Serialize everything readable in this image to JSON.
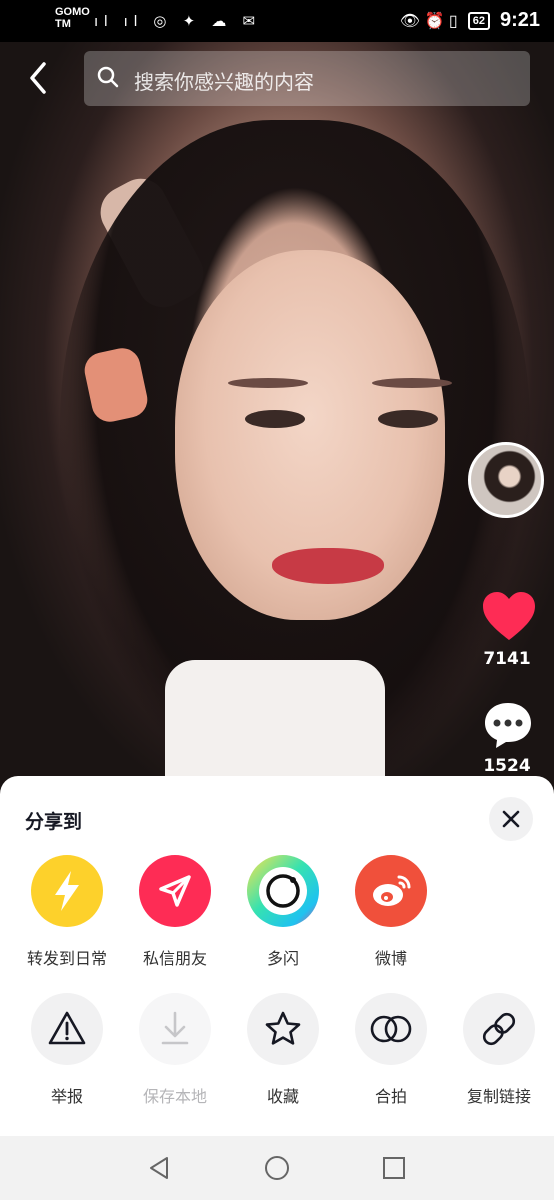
{
  "status_bar": {
    "carrier_line1": "GOMO",
    "carrier_line2": "TM",
    "left_icons": "ıl ıl ◎ ✦ ☁ ✉",
    "right_icons": "👁 ⏰ ▯",
    "battery": "62",
    "time": "9:21"
  },
  "search": {
    "placeholder": "搜索你感兴趣的内容"
  },
  "actions": {
    "like_count": "7141",
    "comment_count": "1524"
  },
  "share_sheet": {
    "title": "分享到",
    "share_targets": [
      {
        "label": "转发到日常",
        "icon": "lightning-icon",
        "color": "#fdd12b"
      },
      {
        "label": "私信朋友",
        "icon": "paper-plane-icon",
        "color": "#fe2c55"
      },
      {
        "label": "多闪",
        "icon": "duoshan-icon",
        "color": "#36e2b0"
      },
      {
        "label": "微博",
        "icon": "weibo-icon",
        "color": "#f0503b"
      }
    ],
    "tools": [
      {
        "label": "举报",
        "icon": "warning-icon",
        "disabled": false
      },
      {
        "label": "保存本地",
        "icon": "download-icon",
        "disabled": true
      },
      {
        "label": "收藏",
        "icon": "star-icon",
        "disabled": false
      },
      {
        "label": "合拍",
        "icon": "duet-icon",
        "disabled": false
      },
      {
        "label": "复制链接",
        "icon": "link-icon",
        "disabled": false
      }
    ]
  },
  "colors": {
    "like": "#fe2c55",
    "sheet_bg": "#ffffff",
    "tool_circle": "#f1f1f2"
  }
}
